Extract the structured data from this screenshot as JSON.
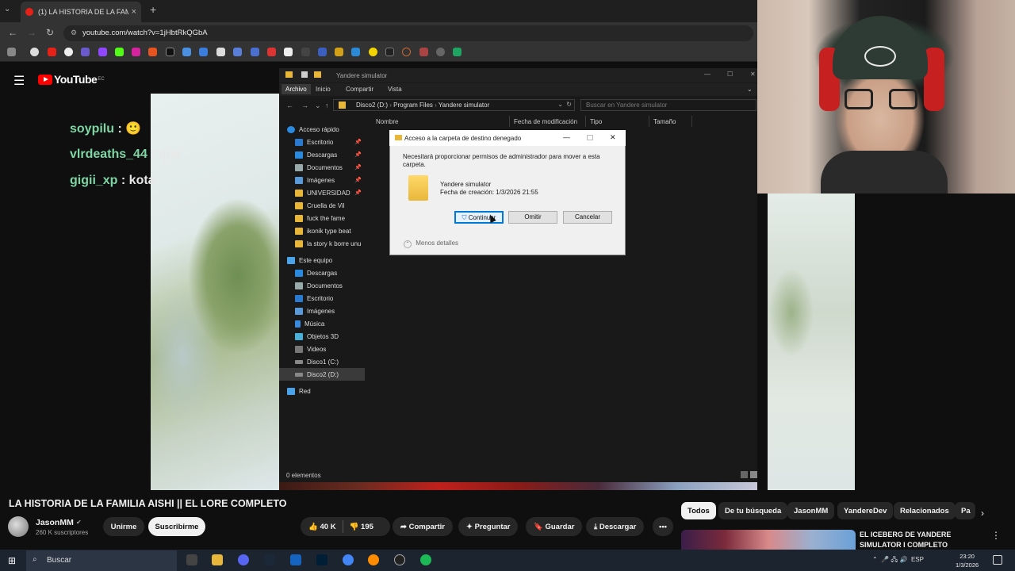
{
  "browser": {
    "tab_title": "(1) LA HISTORIA DE LA FAMILIA AISHI",
    "tab_close": "×",
    "tab_list": "⌄",
    "new_tab": "+",
    "url": "youtube.com/watch?v=1jHbtRkQGbA",
    "back": "←",
    "forward": "→",
    "reload": "↻"
  },
  "youtube": {
    "logo_text": "YouTube",
    "region": "EC",
    "chat": [
      {
        "user": "soypilu",
        "msg": ": 🙂"
      },
      {
        "user": "vlrdeaths_44",
        "msg": ": que"
      },
      {
        "user": "gigii_xp",
        "msg": ": kota"
      }
    ],
    "video_title": "LA HISTORIA DE LA FAMILIA AISHI || EL LORE COMPLETO",
    "channel": "JasonMM",
    "verified": "✔",
    "subscribers": "260 K suscriptores",
    "join_label": "Unirme",
    "subscribe_label": "Suscribirme",
    "likes": "40 K",
    "dislikes": "195",
    "share_label": "Compartir",
    "ask_label": "Preguntar",
    "save_label": "Guardar",
    "download_label": "Descargar",
    "more": "•••",
    "chips": [
      "Todos",
      "De tu búsqueda",
      "JasonMM",
      "YandereDev",
      "Relacionados",
      "Pa"
    ],
    "rec_title": "EL ICEBERG DE YANDERE SIMULATOR I COMPLETO",
    "rec_more": "⋮",
    "chips_next": "›"
  },
  "explorer": {
    "title": "Yandere simulator",
    "ribbon_tabs": [
      "Archivo",
      "Inicio",
      "Compartir",
      "Vista"
    ],
    "path": [
      "Disco2 (D:)",
      "Program Files",
      "Yandere simulator"
    ],
    "search_placeholder": "Buscar en Yandere simulator",
    "columns": [
      "Nombre",
      "Fecha de modificación",
      "Tipo",
      "Tamaño"
    ],
    "quick_access": "Acceso rápido",
    "quick_items": [
      "Escritorio",
      "Descargas",
      "Documentos",
      "Imágenes",
      "UNIVERSIDAD",
      "Cruella de Vil",
      "fuck the fame",
      "ikonik type beat",
      "la story k borre unu"
    ],
    "this_pc": "Este equipo",
    "pc_items": [
      "Descargas",
      "Documentos",
      "Escritorio",
      "Imágenes",
      "Música",
      "Objetos 3D",
      "Videos",
      "Disco1 (C:)",
      "Disco2 (D:)"
    ],
    "network": "Red",
    "status": "0 elementos",
    "window_controls": [
      "—",
      "☐",
      "✕"
    ]
  },
  "dialog": {
    "title": "Acceso a la carpeta de destino denegado",
    "message": "Necesitará proporcionar permisos de administrador para mover a esta carpeta.",
    "folder_name": "Yandere simulator",
    "created": "Fecha de creación: 1/3/2026 21:55",
    "continue_label": "Continuar",
    "skip_label": "Omitir",
    "cancel_label": "Cancelar",
    "less_details": "Menos detalles",
    "minimize": "—",
    "close": "✕"
  },
  "taskbar": {
    "search_placeholder": "Buscar",
    "language": "ESP",
    "time": "23:20",
    "date": "1/3/2026"
  }
}
